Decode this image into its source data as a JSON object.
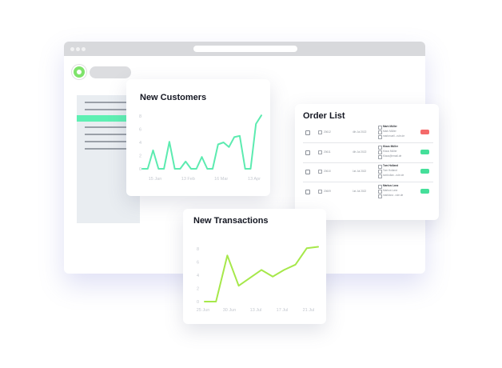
{
  "colors": {
    "accent": "#5ef0b3",
    "customers_line": "#5cebb0",
    "transactions_line": "#a6e84a",
    "badge_red": "#f46a6a",
    "badge_green": "#45df9a"
  },
  "icons": {
    "logo": "logo-icon",
    "order": "document-icon",
    "contact": "person-icon"
  },
  "new_customers": {
    "title": "New Customers",
    "chart_data": {
      "type": "line",
      "title": "New Customers",
      "xlabel": "",
      "ylabel": "",
      "x_tick_labels": [
        "15 Jan",
        "13 Feb",
        "16 Mar",
        "13 Apr"
      ],
      "y_tick_labels": [
        "0",
        "2",
        "4",
        "6",
        "8"
      ],
      "ylim": [
        0,
        8
      ],
      "grid": false,
      "series": [
        {
          "values": [
            0,
            0,
            2.8,
            0,
            0,
            4.1,
            0,
            0,
            1.1,
            0,
            0,
            1.8,
            0,
            0,
            3.7,
            4.0,
            3.3,
            4.8,
            5.0,
            0,
            0,
            6.8,
            8.1
          ]
        }
      ]
    }
  },
  "order_list": {
    "title": "Order List",
    "rows": [
      {
        "id": "20612",
        "date": "4th Jul 2022",
        "name": "Mark Müller",
        "name2": "Mark Müller",
        "note": "markmuell...rule.de",
        "status": "red"
      },
      {
        "id": "20611",
        "date": "4th Jul 2022",
        "name": "Klaus Müller",
        "name2": "Klaus Müller",
        "note": "Klaus@email.de",
        "status": "green"
      },
      {
        "id": "20610",
        "date": "1st Jul 2022",
        "name": "Tom Holland",
        "name2": "Tom Holland",
        "note": "tomhollan...rule.de",
        "status": "green"
      },
      {
        "id": "20609",
        "date": "1st Jul 2022",
        "name": "Markus Lanz",
        "name2": "Markus Lanz",
        "note": "marklanz...rule.de",
        "status": "green"
      }
    ]
  },
  "new_transactions": {
    "title": "New Transactions",
    "chart_data": {
      "type": "line",
      "title": "New Transactions",
      "xlabel": "",
      "ylabel": "",
      "x_tick_labels": [
        "25 Jun",
        "30 Jun",
        "13 Jul",
        "17 Jul",
        "21 Jul"
      ],
      "y_tick_labels": [
        "0",
        "2",
        "4",
        "6",
        "8"
      ],
      "ylim": [
        0,
        8
      ],
      "grid": false,
      "series": [
        {
          "values": [
            0,
            0,
            7.0,
            2.4,
            3.6,
            4.8,
            3.8,
            4.8,
            5.6,
            8.1,
            8.3
          ]
        }
      ]
    }
  }
}
